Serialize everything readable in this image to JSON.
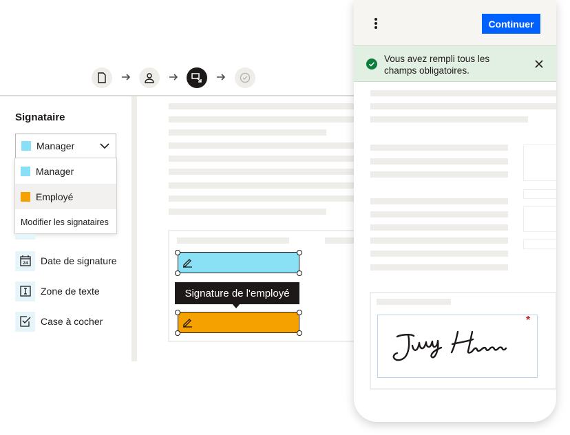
{
  "stepper": {
    "steps": [
      {
        "icon": "document-icon",
        "state": "done"
      },
      {
        "icon": "person-icon",
        "state": "done"
      },
      {
        "icon": "place-fields-icon",
        "state": "active"
      },
      {
        "icon": "check-circle-icon",
        "state": "upcoming"
      }
    ]
  },
  "left_panel": {
    "title": "Signataire",
    "select": {
      "value": "Manager",
      "color": "#87e0f5"
    },
    "menu": {
      "options": [
        {
          "label": "Manager",
          "color": "#87e0f5"
        },
        {
          "label": "Employé",
          "color": "#f5a100"
        }
      ],
      "footer": "Modifier les signataires"
    },
    "fields": [
      {
        "label": "Date de signature",
        "icon": "calendar-icon"
      },
      {
        "label": "Zone de texte",
        "icon": "text-box-icon"
      },
      {
        "label": "Case à cocher",
        "icon": "checkbox-icon"
      }
    ]
  },
  "document": {
    "manager_field_color": "#8ae1f6",
    "employee_field_color": "#f5a100",
    "tooltip": "Signature de l'employé"
  },
  "phone": {
    "continue_label": "Continuer",
    "banner_text": "Vous avez rempli tous les champs obligatoires.",
    "required_mark": "*",
    "brand_color": "#0061fe",
    "success_color": "#0e7e3d"
  }
}
